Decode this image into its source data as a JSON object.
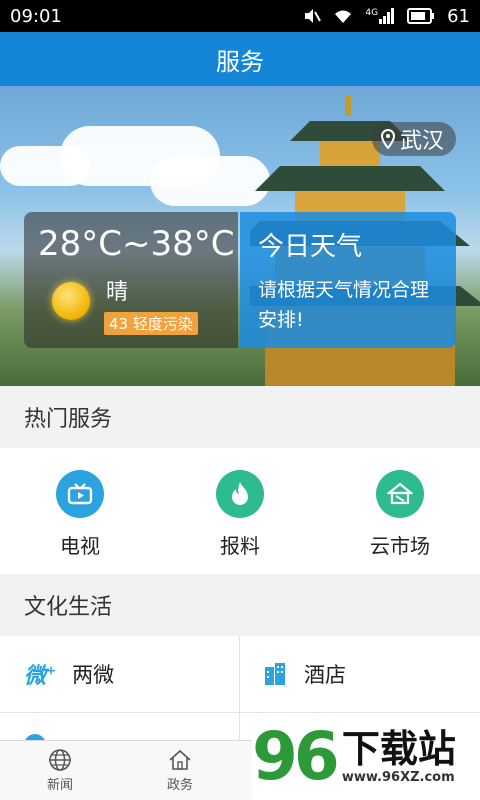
{
  "status_bar": {
    "time": "09:01",
    "network": "4G",
    "battery": "61"
  },
  "app_bar": {
    "title": "服务"
  },
  "hero": {
    "location": "武汉",
    "weather": {
      "temperature": "28°C~38°C",
      "condition": "晴",
      "air_quality": "43 轻度污染"
    },
    "tip": {
      "title": "今日天气",
      "text": "请根据天气情况合理安排!"
    }
  },
  "hot_services": {
    "title": "热门服务",
    "items": [
      {
        "label": "电视",
        "icon": "tv-icon",
        "color": "#2aa3e0"
      },
      {
        "label": "报料",
        "icon": "flame-icon",
        "color": "#2dbb8f"
      },
      {
        "label": "云市场",
        "icon": "market-icon",
        "color": "#2dbb8f"
      }
    ]
  },
  "culture": {
    "title": "文化生活",
    "items": [
      {
        "label": "两微",
        "icon": "weibo-weixin-icon"
      },
      {
        "label": "酒店",
        "icon": "hotel-icon"
      }
    ]
  },
  "tab_bar": {
    "items": [
      {
        "label": "新闻",
        "icon": "globe-icon"
      },
      {
        "label": "政务",
        "icon": "home-icon"
      }
    ]
  },
  "watermark": {
    "logo": "96",
    "name": "下载站",
    "url": "www.96XZ.com"
  },
  "colors": {
    "primary": "#1585d8",
    "accent_green": "#2dbb8f",
    "pollution_badge": "#f2a23c"
  }
}
